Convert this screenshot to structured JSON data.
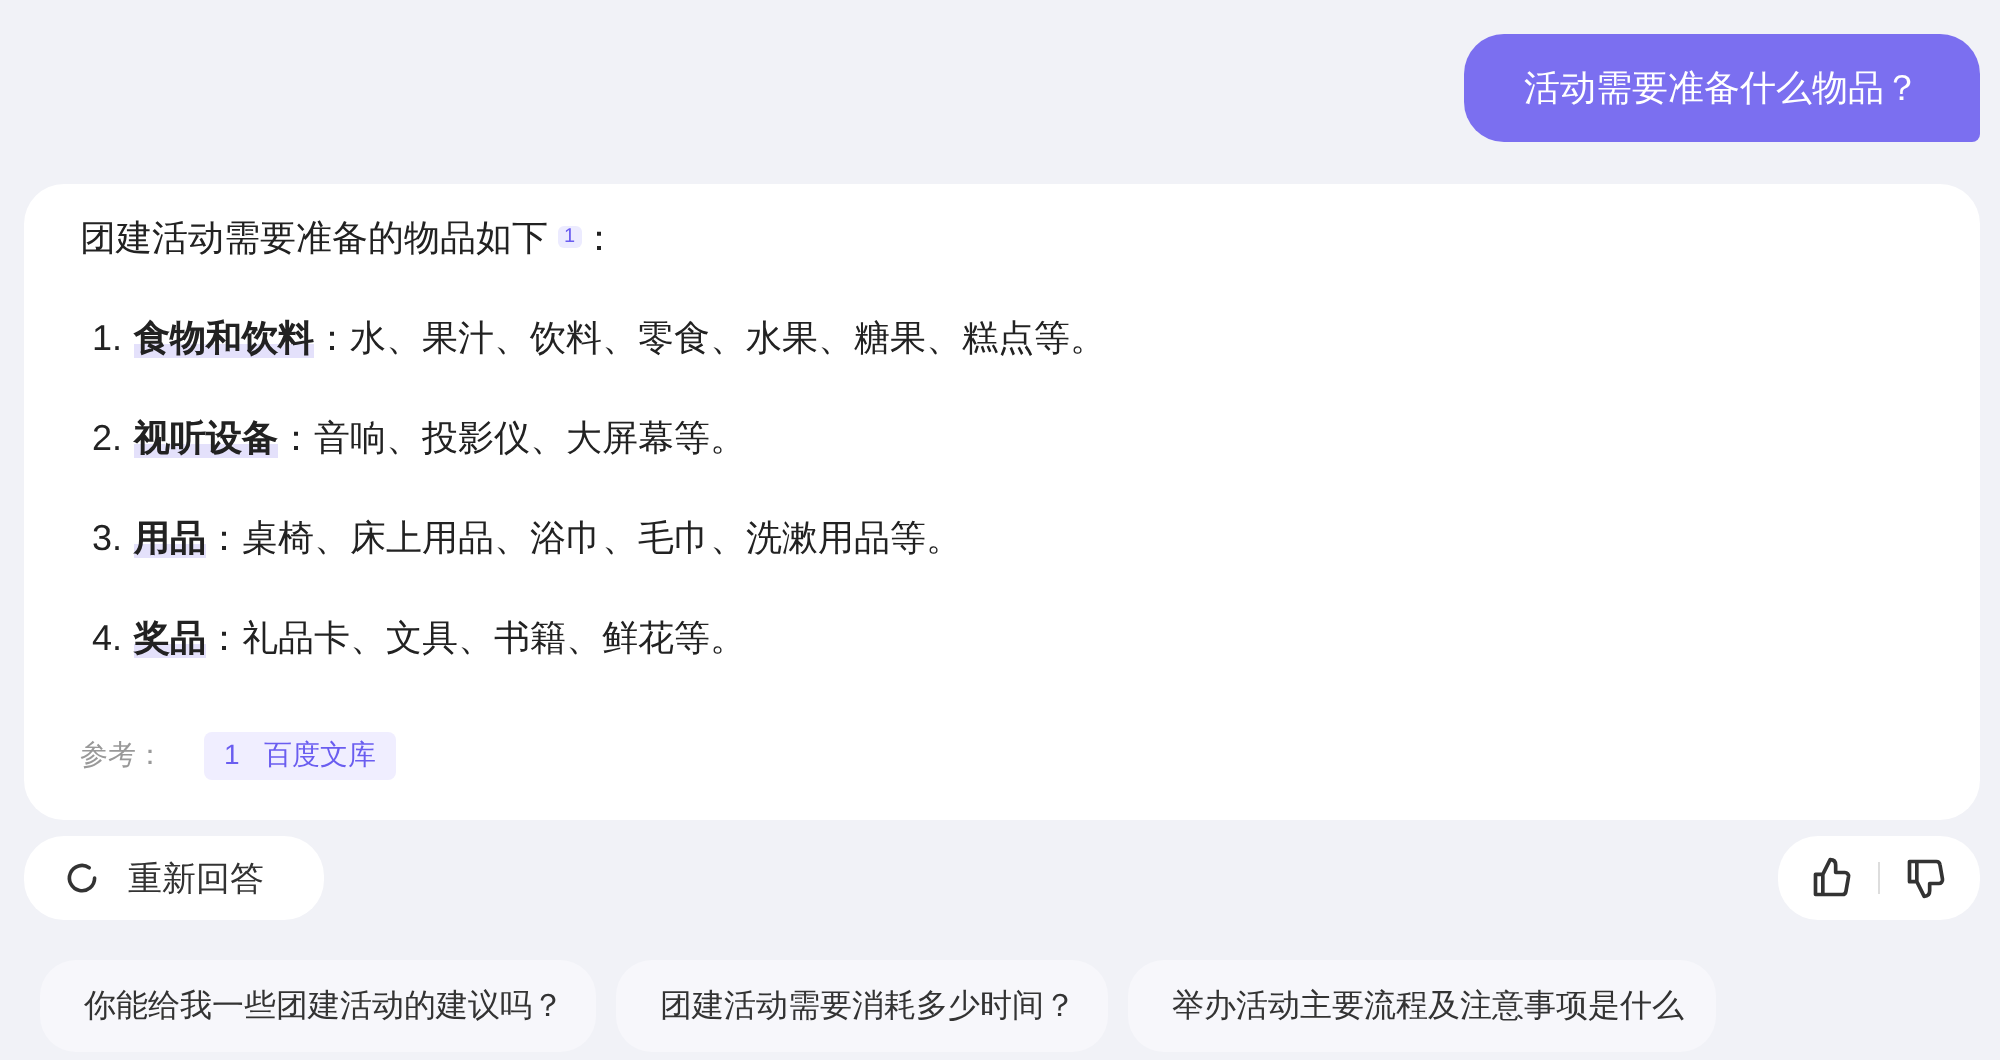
{
  "user_message": {
    "text": "活动需要准备什么物品？"
  },
  "answer": {
    "intro": "团建活动需要准备的物品如下 $^{1}$：",
    "items": [
      {
        "number": "1.",
        "text": "**食物和饮料**：水、果汁、饮料、零食、水果、糖果、糕点等。"
      },
      {
        "number": "2.",
        "text": "**视听设备**：音响、投影仪、大屏幕等。"
      },
      {
        "number": "3.",
        "text": "**用品**：桌椅、床上用品、浴巾、毛巾、洗漱用品等。"
      },
      {
        "number": "4.",
        "text": "**奖品**：礼品卡、文具、书籍、鲜花等。"
      }
    ],
    "reference_label": "参考：",
    "references": [
      {
        "index": "1",
        "source": "百度文库"
      }
    ]
  },
  "regenerate_button": {
    "label": "重新回答"
  },
  "suggestions": [
    "你能给我一些团建活动的建议吗？",
    "团建活动需要消耗多少时间？",
    "举办活动主要流程及注意事项是什么"
  ]
}
